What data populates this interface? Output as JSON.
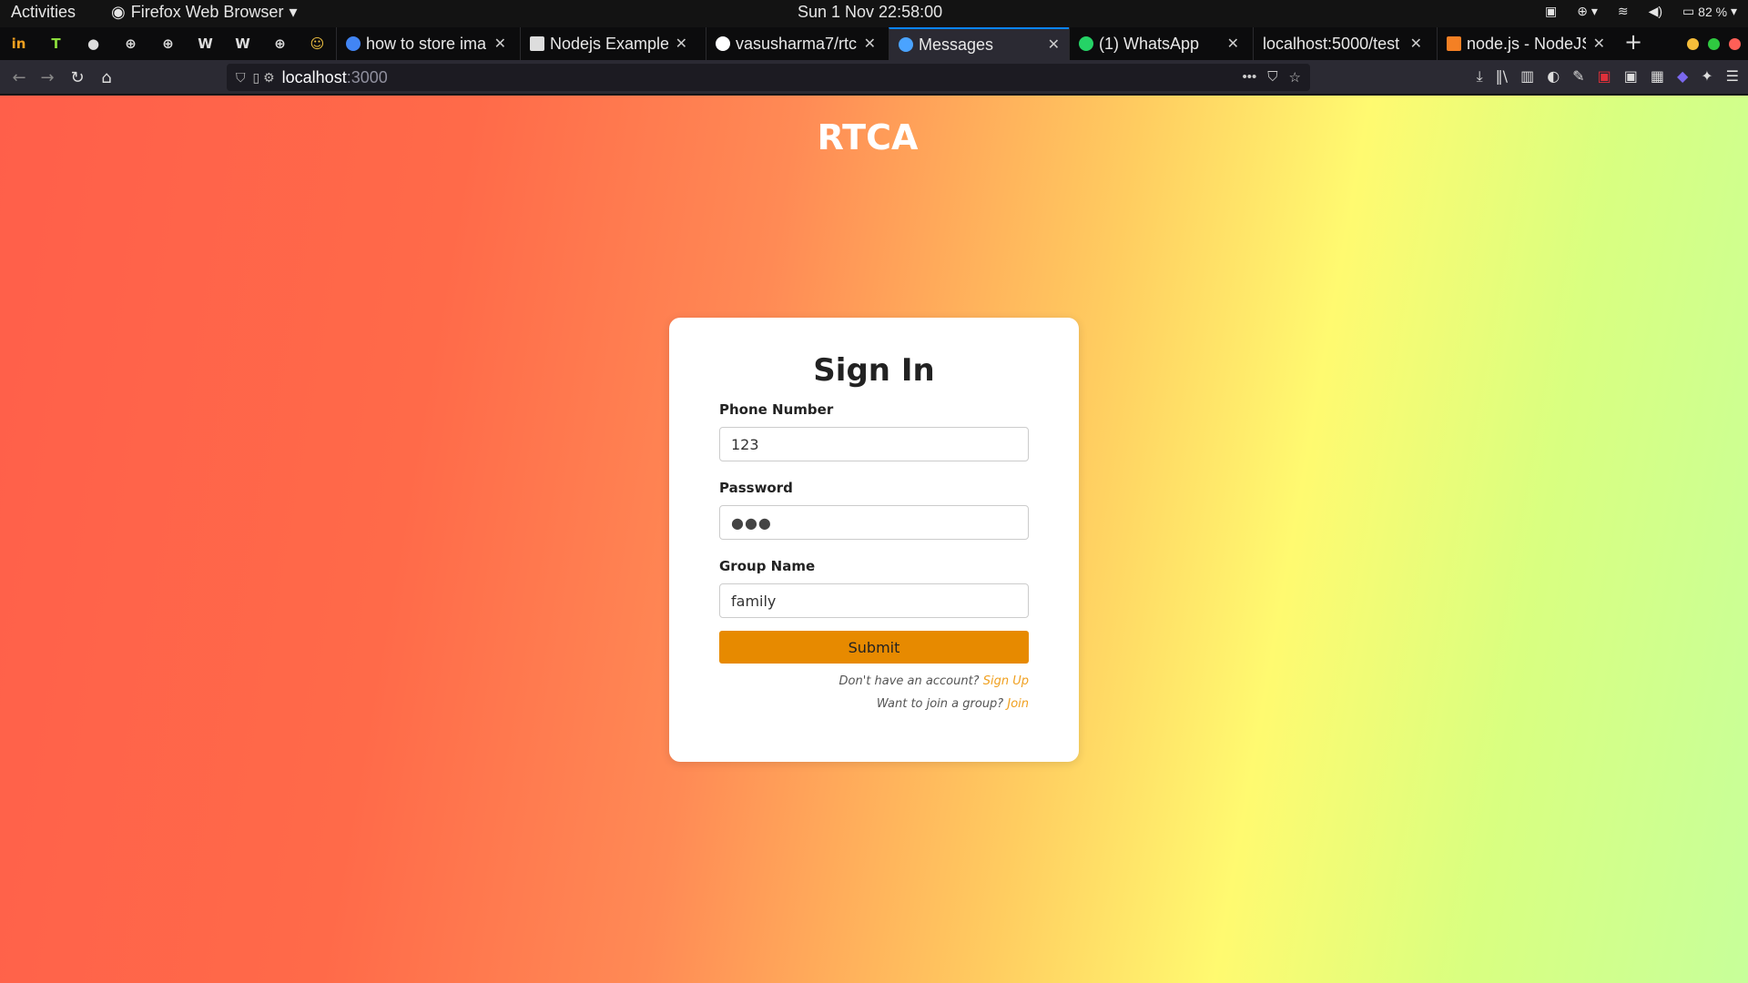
{
  "system": {
    "activities": "Activities",
    "app_name": "Firefox Web Browser",
    "clock": "Sun 1 Nov  22:58:00",
    "battery": "82 %"
  },
  "tabs": [
    {
      "title": "how to store ima",
      "fav_color": "#4285f4"
    },
    {
      "title": "Nodejs Example",
      "fav_color": "#dddddd"
    },
    {
      "title": "vasusharma7/rtc",
      "fav_color": "#ffffff"
    },
    {
      "title": "Messages",
      "fav_color": "#4aa3ff"
    },
    {
      "title": "(1) WhatsApp",
      "fav_color": "#25d366"
    },
    {
      "title": "localhost:5000/test",
      "fav_color": "#888888"
    },
    {
      "title": "node.js - NodeJS",
      "fav_color": "#f48024"
    }
  ],
  "pinned_tabs": [
    "in",
    "I",
    "gh",
    "web",
    "web",
    "W",
    "W",
    "web",
    "emoji"
  ],
  "urlbar": {
    "host": "localhost",
    "port": ":3000"
  },
  "page": {
    "brand": "RTCA",
    "form": {
      "title": "Sign In",
      "phone_label": "Phone Number",
      "phone_value": "123",
      "password_label": "Password",
      "password_value": "●●●",
      "group_label": "Group Name",
      "group_value": "family",
      "submit_label": "Submit",
      "signup_prompt": "Don't have an account?",
      "signup_link": "Sign Up",
      "join_prompt": "Want to join a group?",
      "join_link": "Join"
    }
  }
}
